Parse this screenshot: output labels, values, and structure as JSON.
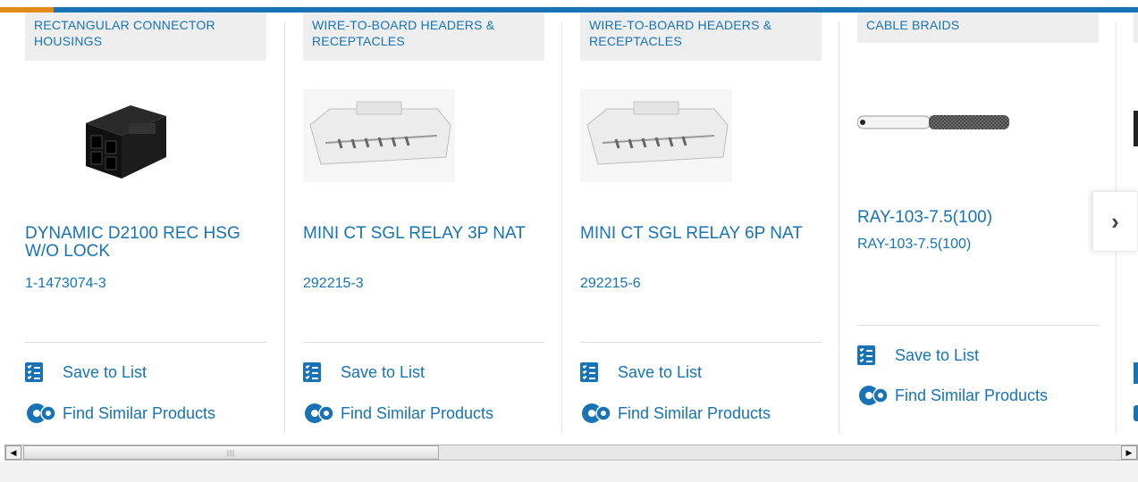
{
  "colors": {
    "accent_blue": "#1773b5",
    "accent_orange": "#e28a1a",
    "category_bg": "#eeeeee"
  },
  "products": [
    {
      "category": "RECTANGULAR CONNECTOR HOUSINGS",
      "title": "DYNAMIC D2100 REC HSG W/O LOCK",
      "part_number": "1-1473074-3",
      "save_label": "Save to List",
      "similar_label": "Find Similar Products"
    },
    {
      "category": "WIRE-TO-BOARD HEADERS & RECEPTACLES",
      "title": "MINI CT SGL RELAY 3P NAT",
      "part_number": "292215-3",
      "save_label": "Save to List",
      "similar_label": "Find Similar Products"
    },
    {
      "category": "WIRE-TO-BOARD HEADERS & RECEPTACLES",
      "title": "MINI CT SGL RELAY 6P NAT",
      "part_number": "292215-6",
      "save_label": "Save to List",
      "similar_label": "Find Similar Products"
    },
    {
      "category": "CABLE BRAIDS",
      "title": "RAY-103-7.5(100)",
      "part_number": "RAY-103-7.5(100)",
      "save_label": "Save to List",
      "similar_label": "Find Similar Products"
    }
  ],
  "carousel": {
    "next_icon": "chevron-right-icon",
    "next_glyph": "›"
  },
  "scrollbar": {
    "left_arrow": "◀",
    "right_arrow": "▶",
    "grip": "|||"
  }
}
